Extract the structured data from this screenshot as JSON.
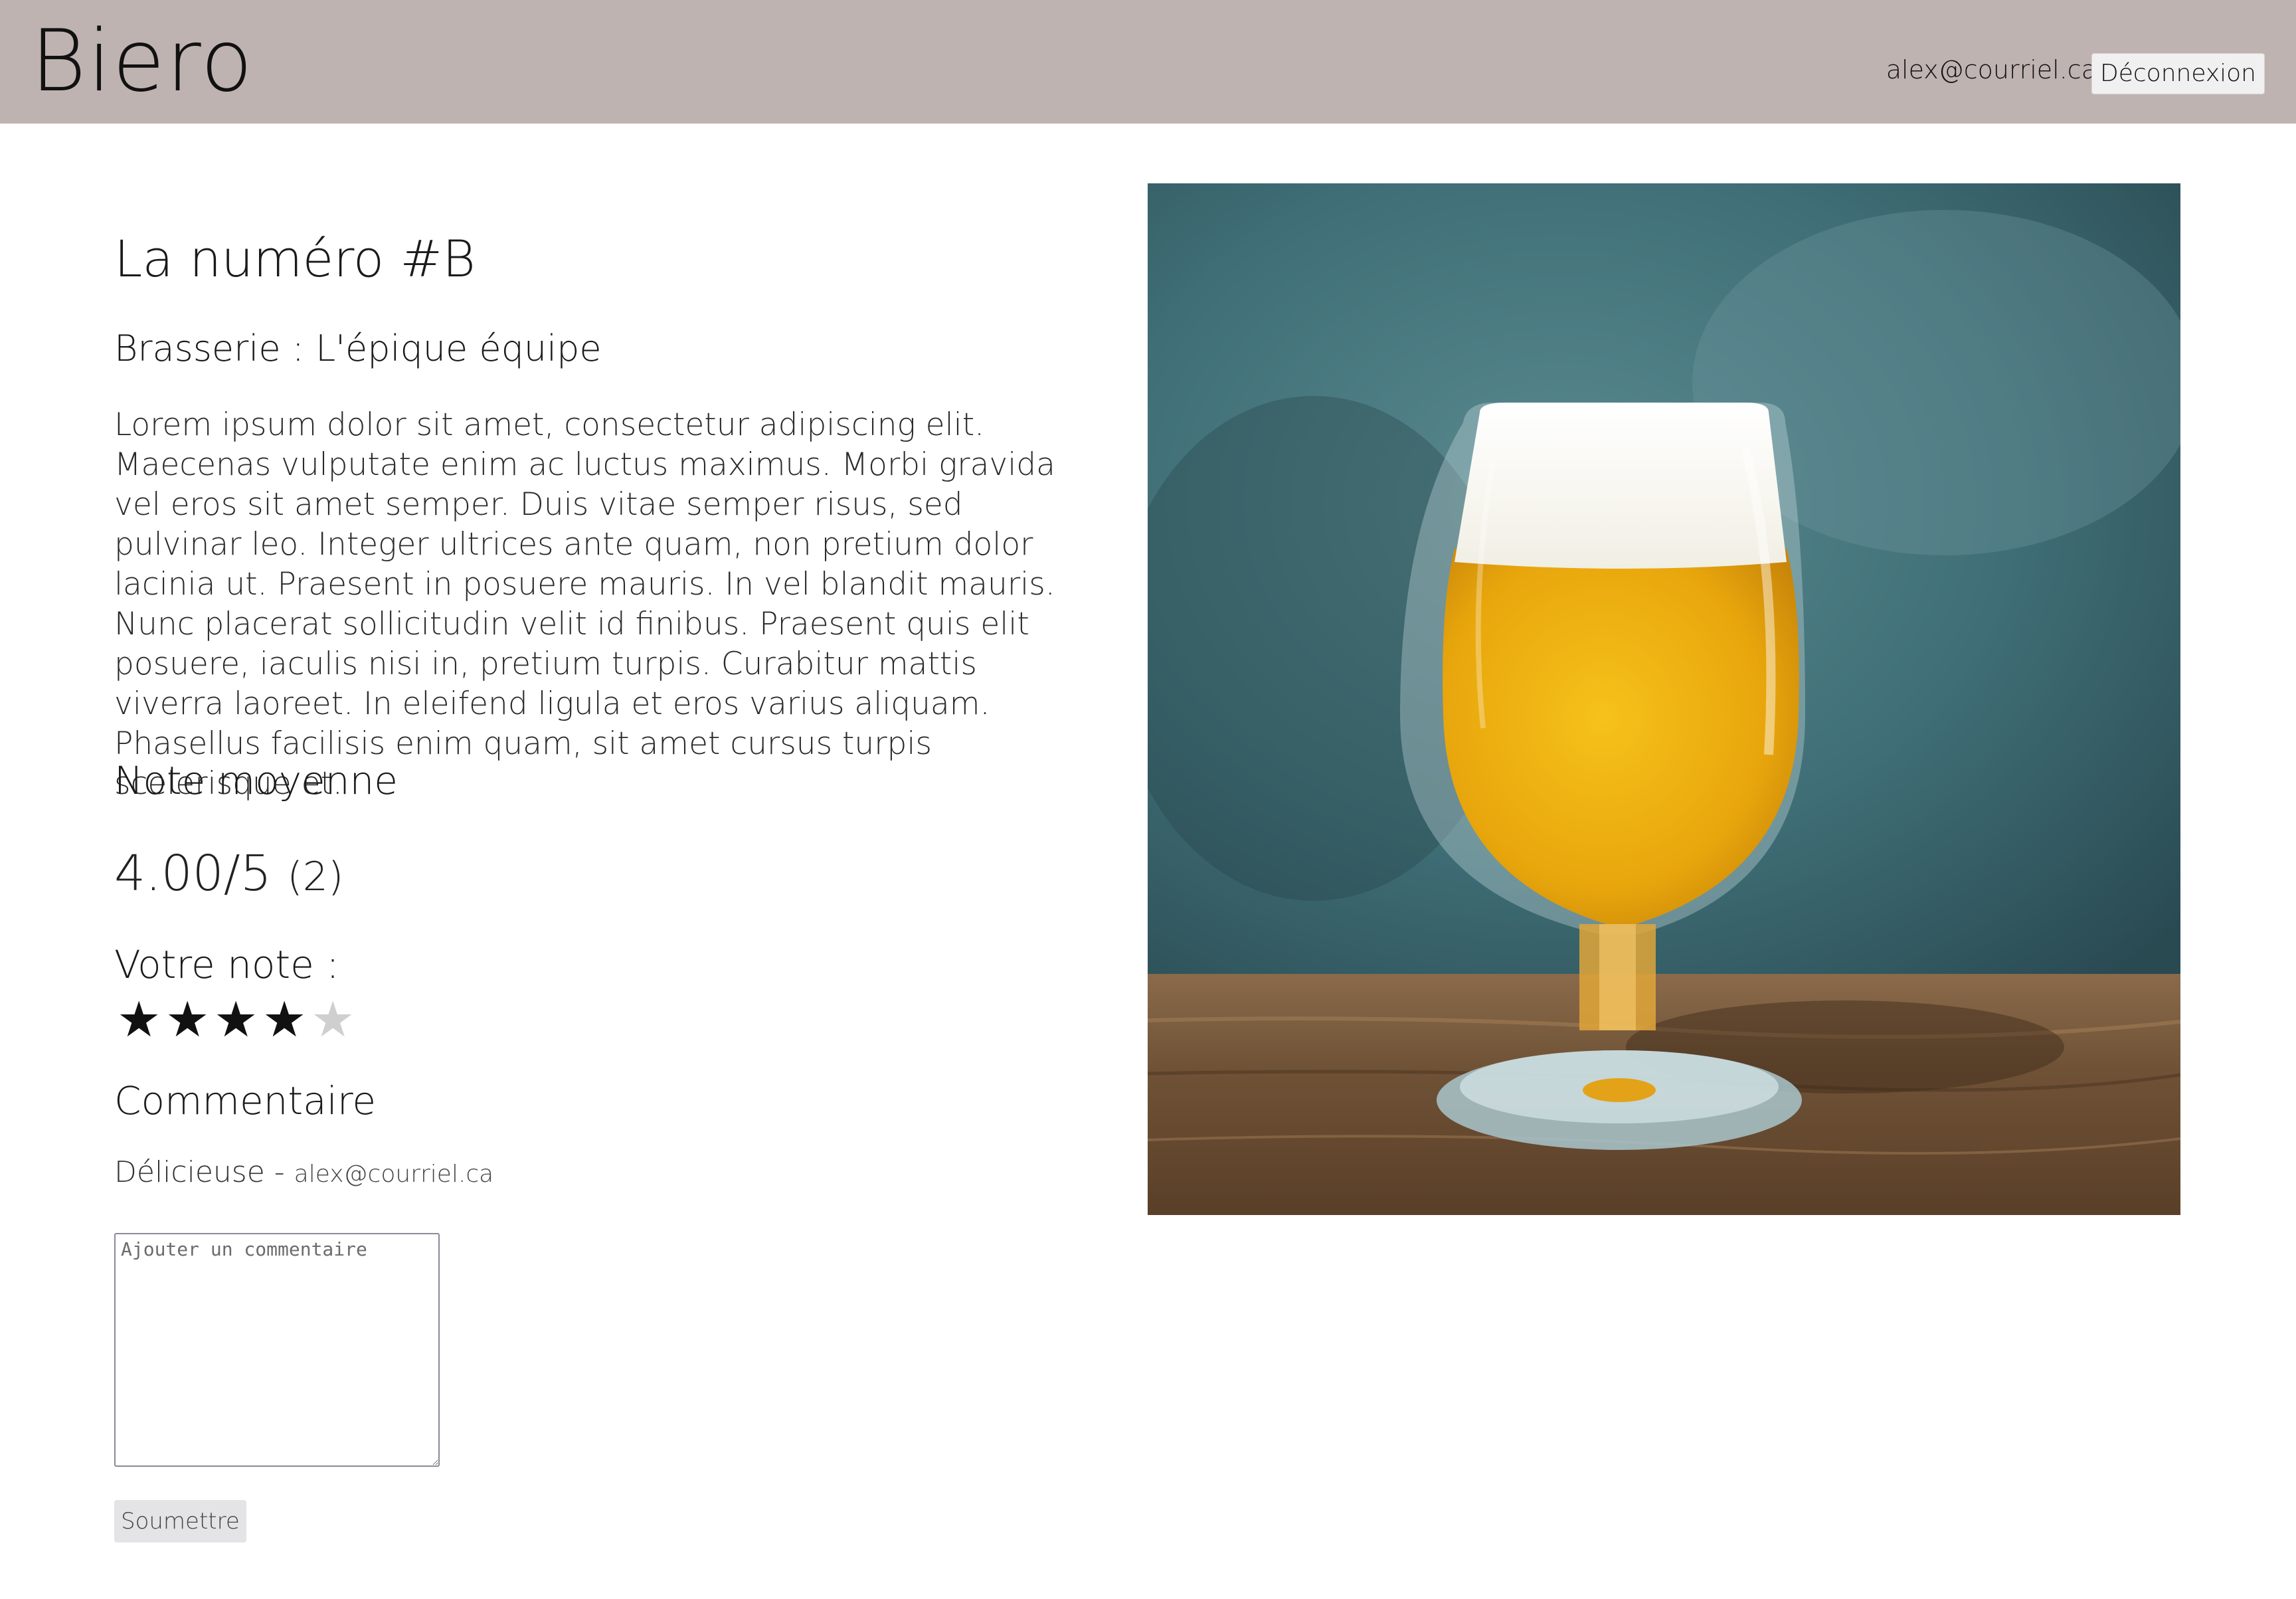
{
  "header": {
    "logo": "Biero",
    "user_email": "alex@courriel.ca",
    "logout_label": "Déconnexion"
  },
  "beer": {
    "title": "La numéro #B",
    "brewery": "Brasserie : L'épique équipe",
    "description": "Lorem ipsum dolor sit amet, consectetur adipiscing elit. Maecenas vulputate enim ac luctus maximus. Morbi gravida vel eros sit amet semper. Duis vitae semper risus, sed pulvinar leo. Integer ultrices ante quam, non pretium dolor lacinia ut. Praesent in posuere mauris. In vel blandit mauris. Nunc placerat sollicitudin velit id finibus. Praesent quis elit posuere, iaculis nisi in, pretium turpis. Curabitur mattis viverra laoreet. In eleifend ligula et eros varius aliquam. Phasellus facilisis enim quam, sit amet cursus turpis scelerisque et.",
    "image_icon": "beer-glass-photo"
  },
  "rating": {
    "average_heading": "Note moyenne",
    "average_value": "4.00/5",
    "average_count": "(2)",
    "your_rating_label": "Votre note :",
    "your_rating": 4,
    "max_rating": 5,
    "star_glyph": "★"
  },
  "comments": {
    "heading": "Commentaire",
    "items": [
      {
        "text": "Délicieuse",
        "separator": "-",
        "author": "alex@courriel.ca"
      }
    ],
    "input_placeholder": "Ajouter un commentaire",
    "submit_label": "Soumettre"
  },
  "colors": {
    "header_bg": "#bfb3b2",
    "star_on": "#111111",
    "star_off": "#cfcfcf"
  }
}
